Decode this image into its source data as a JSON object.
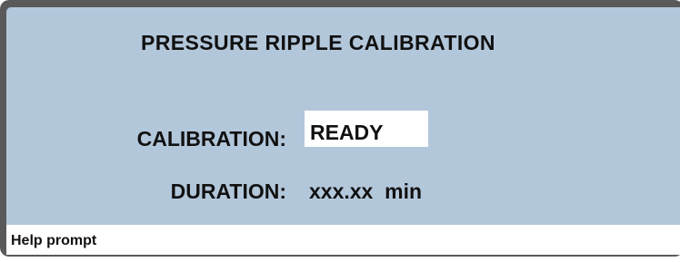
{
  "screen": {
    "title": "PRESSURE RIPPLE CALIBRATION"
  },
  "calibration": {
    "label": "CALIBRATION:",
    "status": "READY"
  },
  "duration": {
    "label": "DURATION:",
    "value": "xxx.xx  min"
  },
  "help_bar": {
    "text": "Help prompt"
  },
  "colors": {
    "frame": "#5a5a5a",
    "screen_background": "#b3c7db",
    "field_background": "#ffffff",
    "text": "#111111"
  }
}
